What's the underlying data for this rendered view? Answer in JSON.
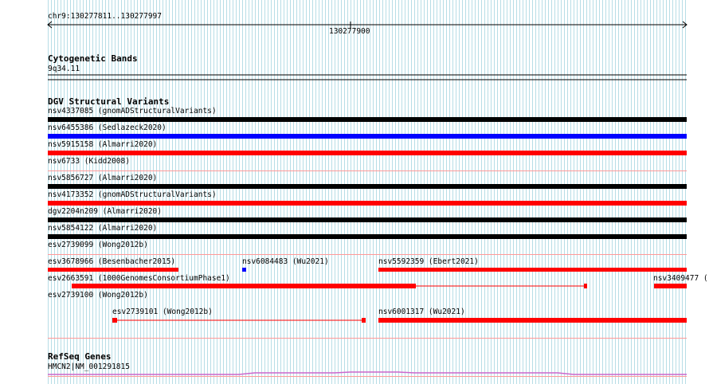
{
  "ruler": {
    "range_label": "chr9:130277811..130277997",
    "tick_label": "130277900"
  },
  "cytogenetic": {
    "title": "Cytogenetic Bands",
    "band": "9q34.11"
  },
  "dgv": {
    "title": "DGV Structural Variants",
    "colors": {
      "black": "#000000",
      "blue": "#0000ff",
      "red": "#ff0000"
    },
    "features": [
      {
        "id": "nsv4337085",
        "source": "gnomADStructuralVariants",
        "color": "black"
      },
      {
        "id": "nsv6455386",
        "source": "Sedlazeck2020",
        "color": "blue"
      },
      {
        "id": "nsv5915158",
        "source": "Almarri2020",
        "color": "red"
      },
      {
        "id": "nsv6733",
        "source": "Kidd2008",
        "color": "red"
      },
      {
        "id": "nsv5856727",
        "source": "Almarri2020",
        "color": "black"
      },
      {
        "id": "nsv4173352",
        "source": "gnomADStructuralVariants",
        "color": "red"
      },
      {
        "id": "dgv2204n209",
        "source": "Almarri2020",
        "color": "black"
      },
      {
        "id": "nsv5854122",
        "source": "Almarri2020",
        "color": "black"
      },
      {
        "id": "esv2739099",
        "source": "Wong2012b",
        "color": "red"
      },
      {
        "id": "esv3678966",
        "source": "Besenbacher2015",
        "color": "red"
      },
      {
        "id": "nsv6084483",
        "source": "Wu2021",
        "color": "blue"
      },
      {
        "id": "nsv5592359",
        "source": "Ebert2021",
        "color": "red"
      },
      {
        "id": "esv2663591",
        "source": "1000GenomesConsortiumPhase1",
        "color": "red"
      },
      {
        "id": "nsv3409477",
        "source": "",
        "color": "red"
      },
      {
        "id": "esv2739100",
        "source": "Wong2012b",
        "color": "red"
      },
      {
        "id": "esv2739101",
        "source": "Wong2012b",
        "color": "red"
      },
      {
        "id": "nsv6001317",
        "source": "Wu2021",
        "color": "red"
      }
    ],
    "labels": {
      "f0": "nsv4337085 (gnomADStructuralVariants)",
      "f1": "nsv6455386 (Sedlazeck2020)",
      "f2": "nsv5915158 (Almarri2020)",
      "f3": "nsv6733 (Kidd2008)",
      "f4": "nsv5856727 (Almarri2020)",
      "f5": "nsv4173352 (gnomADStructuralVariants)",
      "f6": "dgv2204n209 (Almarri2020)",
      "f7": "nsv5854122 (Almarri2020)",
      "f8": "esv2739099 (Wong2012b)",
      "f9": "esv3678966 (Besenbacher2015)",
      "f10": "nsv6084483 (Wu2021)",
      "f11": "nsv5592359 (Ebert2021)",
      "f12": "esv2663591 (1000GenomesConsortiumPhase1)",
      "f13": "nsv3409477 (",
      "f14": "esv2739100 (Wong2012b)",
      "f15": "esv2739101 (Wong2012b)",
      "f16": "nsv6001317 (Wu2021)"
    }
  },
  "refseq": {
    "title": "RefSeq Genes",
    "gene_label": "HMCN2|NM_001291815",
    "color": "#cc66cc"
  }
}
